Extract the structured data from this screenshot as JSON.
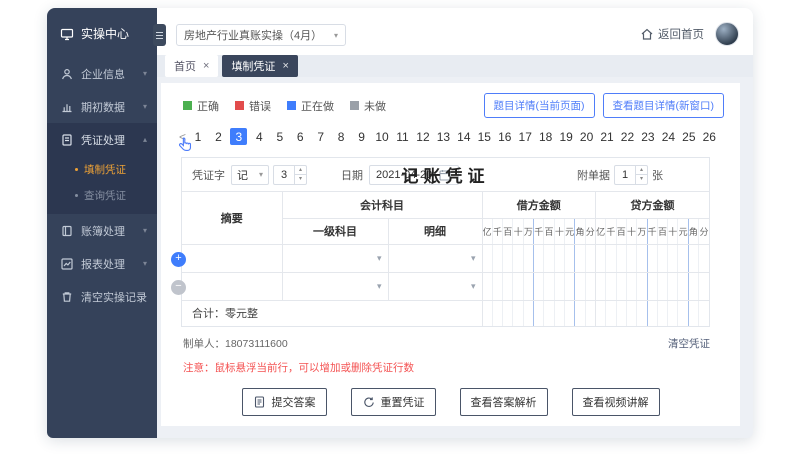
{
  "icons": {
    "caret_down": "▾",
    "caret_up": "▴",
    "close": "×",
    "prev": "<"
  },
  "topbar": {
    "course": "房地产行业真账实操（4月）",
    "back_home": "返回首页"
  },
  "tabs": [
    {
      "label": "首页"
    },
    {
      "label": "填制凭证"
    }
  ],
  "sidebar": {
    "brand": "实操中心",
    "items": [
      {
        "label": "企业信息"
      },
      {
        "label": "期初数据"
      },
      {
        "label": "凭证处理"
      },
      {
        "label": "账簿处理"
      },
      {
        "label": "报表处理"
      },
      {
        "label": "清空实操记录"
      }
    ],
    "submenu": [
      {
        "label": "填制凭证"
      },
      {
        "label": "查询凭证"
      }
    ]
  },
  "legend": [
    {
      "label": "正确",
      "color": "#4cb050"
    },
    {
      "label": "错误",
      "color": "#e24c4c"
    },
    {
      "label": "正在做",
      "color": "#3f7dfc"
    },
    {
      "label": "未做",
      "color": "#9aa0a8"
    }
  ],
  "detail_buttons": [
    {
      "label": "题目详情(当前页面)"
    },
    {
      "label": "查看题目详情(新窗口)"
    }
  ],
  "pagination": {
    "active_page": "3",
    "pages": [
      "1",
      "2",
      "3",
      "4",
      "5",
      "6",
      "7",
      "8",
      "9",
      "10",
      "11",
      "12",
      "13",
      "14",
      "15",
      "16",
      "17",
      "18",
      "19",
      "20",
      "21",
      "22",
      "23",
      "24",
      "25",
      "26"
    ]
  },
  "voucher": {
    "word_label": "凭证字",
    "word_value": "记",
    "number_value": "3",
    "date_label": "日期",
    "date_value": "2021-04-20",
    "title": "记账凭证",
    "attach_label": "附单据",
    "attach_value": "1",
    "attach_unit": "张",
    "table": {
      "summary_header": "摘要",
      "subject_header": "会计科目",
      "subject_level1": "一级科目",
      "subject_detail": "明细",
      "debit_header": "借方金额",
      "credit_header": "贷方金额",
      "digits": [
        "亿",
        "千",
        "百",
        "十",
        "万",
        "千",
        "百",
        "十",
        "元",
        "角",
        "分"
      ],
      "total_label": "合计：零元整"
    },
    "preparer": "制单人：18073111600",
    "clear_label": "清空凭证"
  },
  "note": "注意：鼠标悬浮当前行，可以增加或删除凭证行数",
  "actions": [
    {
      "label": "提交答案"
    },
    {
      "label": "重置凭证"
    },
    {
      "label": "查看答案解析"
    },
    {
      "label": "查看视频讲解"
    }
  ],
  "colors": {
    "accent_blue": "#3f7dfc",
    "sidebar_bg": "#35425a",
    "active_tab_bg": "#3a465c",
    "submenu_active": "#eea236",
    "note_red": "#f45252"
  }
}
